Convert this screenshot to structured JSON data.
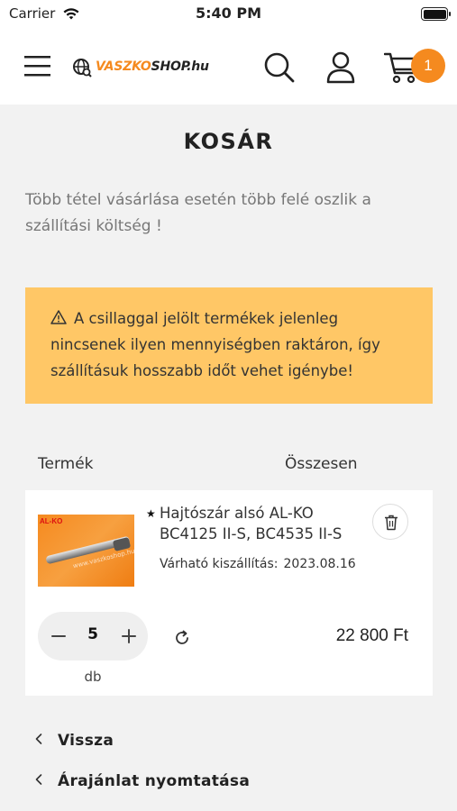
{
  "status_bar": {
    "carrier": "Carrier",
    "time": "5:40 PM"
  },
  "header": {
    "logo_part1": "VASZKO",
    "logo_part2": "SHOP",
    "logo_part3": ".hu",
    "cart_count": "1",
    "brand_color": "#f58a1f"
  },
  "page": {
    "title": "KOSÁR",
    "shipping_note": "Több tétel vásárlása esetén több felé oszlik a szállítási költség !",
    "warning": "A csillaggal jelölt termékek jelenleg nincsenek ilyen mennyiségben raktáron, így szállításuk hosszabb időt vehet igénybe!",
    "warning_color": "#ffc766"
  },
  "table": {
    "col_product": "Termék",
    "col_total": "Összesen"
  },
  "cart_item": {
    "image_brand": "AL-KO",
    "image_watermark": "www.vaszkoshop.hu",
    "star": "★",
    "name": "Hajtószár alsó AL-KO BC4125 II-S, BC4535 II-S",
    "delivery_label": "Várható kiszállítás:",
    "delivery_date": "2023.08.16",
    "quantity": "5",
    "unit": "db",
    "line_total": "22 800 Ft"
  },
  "links": {
    "back": "Vissza",
    "print_quote": "Árajánlat nyomtatása"
  },
  "icons": [
    "wifi-icon",
    "battery-icon",
    "menu-icon",
    "globe-icon",
    "search-icon",
    "user-icon",
    "cart-icon",
    "warning-icon",
    "trash-icon",
    "minus-icon",
    "plus-icon",
    "refresh-icon",
    "chevron-left-icon"
  ]
}
